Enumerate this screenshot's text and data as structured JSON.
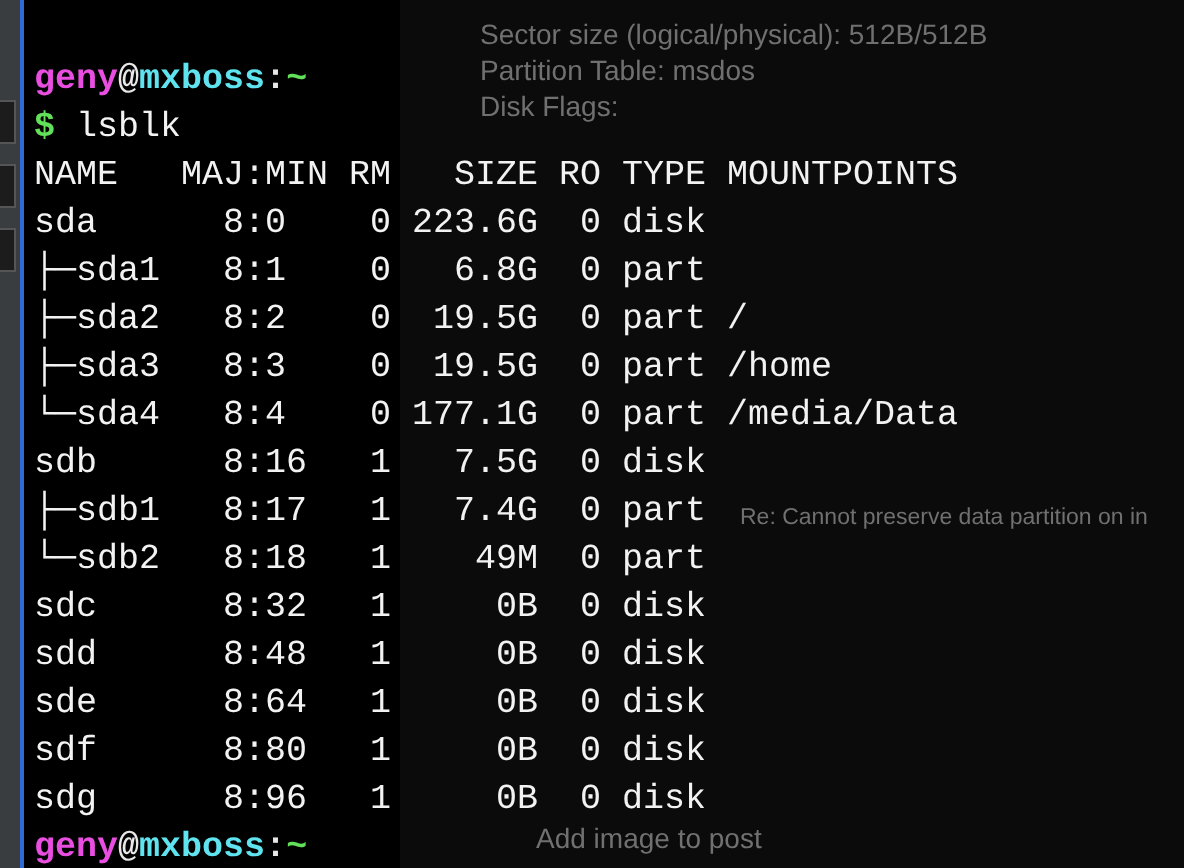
{
  "background_window": {
    "lines": [
      "Sector size (logical/physical): 512B/512B",
      "Partition Table: msdos",
      "Disk Flags:"
    ],
    "subject_reply": "Re: Cannot preserve data partition on in",
    "add_image": "Add image to post"
  },
  "terminal": {
    "prompt": {
      "user": "geny",
      "at": "@",
      "host": "mxboss",
      "sep": ":",
      "path": "~"
    },
    "command": {
      "symbol": "$",
      "text": "lsblk"
    },
    "columns": [
      "NAME",
      "MAJ:MIN",
      "RM",
      "SIZE",
      "RO",
      "TYPE",
      "MOUNTPOINTS"
    ],
    "rows": [
      {
        "name": "sda",
        "majmin": "8:0",
        "rm": "0",
        "size": "223.6G",
        "ro": "0",
        "type": "disk",
        "mountpoint": ""
      },
      {
        "name": "├─sda1",
        "majmin": "8:1",
        "rm": "0",
        "size": "6.8G",
        "ro": "0",
        "type": "part",
        "mountpoint": ""
      },
      {
        "name": "├─sda2",
        "majmin": "8:2",
        "rm": "0",
        "size": "19.5G",
        "ro": "0",
        "type": "part",
        "mountpoint": "/"
      },
      {
        "name": "├─sda3",
        "majmin": "8:3",
        "rm": "0",
        "size": "19.5G",
        "ro": "0",
        "type": "part",
        "mountpoint": "/home"
      },
      {
        "name": "└─sda4",
        "majmin": "8:4",
        "rm": "0",
        "size": "177.1G",
        "ro": "0",
        "type": "part",
        "mountpoint": "/media/Data"
      },
      {
        "name": "sdb",
        "majmin": "8:16",
        "rm": "1",
        "size": "7.5G",
        "ro": "0",
        "type": "disk",
        "mountpoint": ""
      },
      {
        "name": "├─sdb1",
        "majmin": "8:17",
        "rm": "1",
        "size": "7.4G",
        "ro": "0",
        "type": "part",
        "mountpoint": ""
      },
      {
        "name": "└─sdb2",
        "majmin": "8:18",
        "rm": "1",
        "size": "49M",
        "ro": "0",
        "type": "part",
        "mountpoint": ""
      },
      {
        "name": "sdc",
        "majmin": "8:32",
        "rm": "1",
        "size": "0B",
        "ro": "0",
        "type": "disk",
        "mountpoint": ""
      },
      {
        "name": "sdd",
        "majmin": "8:48",
        "rm": "1",
        "size": "0B",
        "ro": "0",
        "type": "disk",
        "mountpoint": ""
      },
      {
        "name": "sde",
        "majmin": "8:64",
        "rm": "1",
        "size": "0B",
        "ro": "0",
        "type": "disk",
        "mountpoint": ""
      },
      {
        "name": "sdf",
        "majmin": "8:80",
        "rm": "1",
        "size": "0B",
        "ro": "0",
        "type": "disk",
        "mountpoint": ""
      },
      {
        "name": "sdg",
        "majmin": "8:96",
        "rm": "1",
        "size": "0B",
        "ro": "0",
        "type": "disk",
        "mountpoint": ""
      }
    ],
    "final_prompt": {
      "user": "geny",
      "at": "@",
      "host": "mxboss",
      "sep": ":",
      "path": "~"
    }
  }
}
